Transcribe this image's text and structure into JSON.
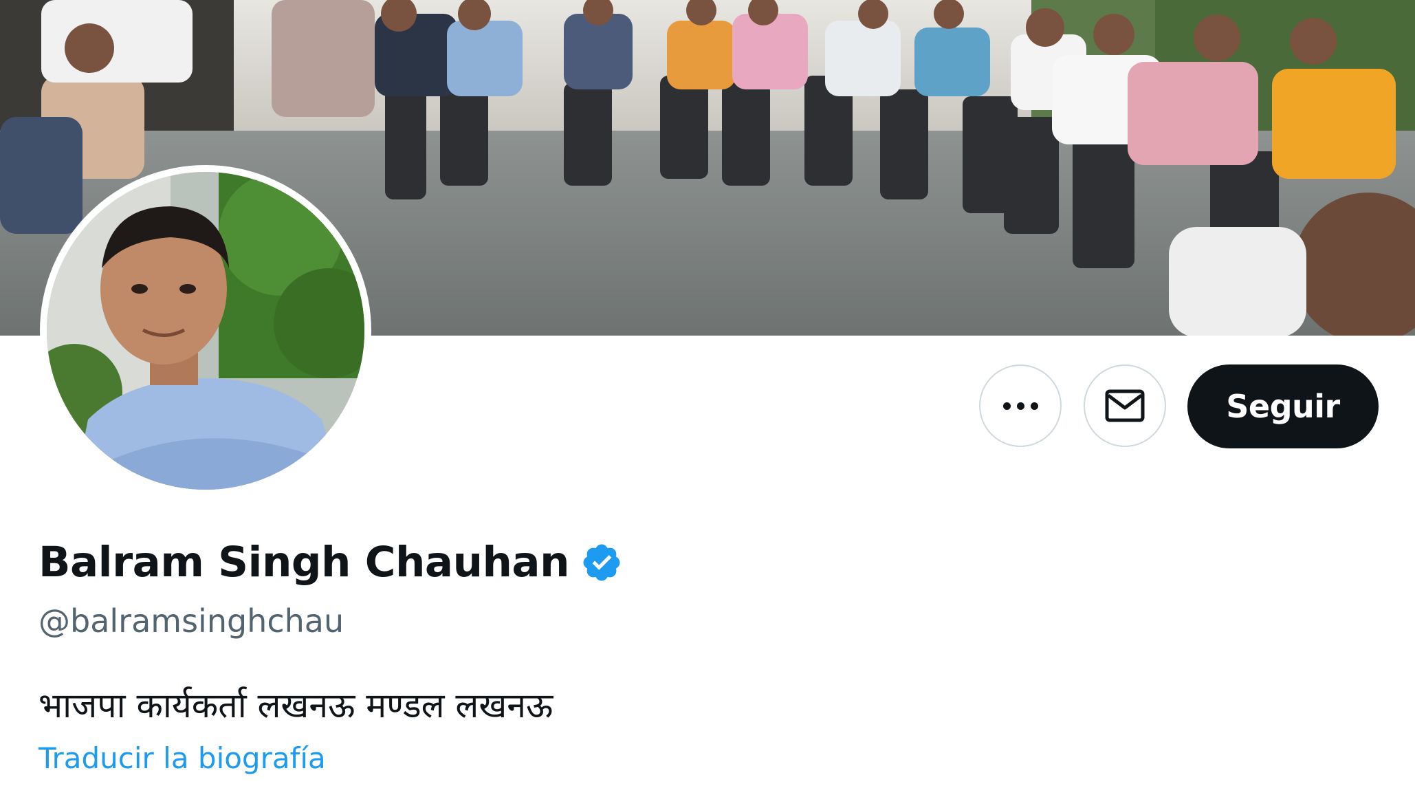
{
  "profile": {
    "display_name": "Balram Singh Chauhan",
    "handle": "@balramsinghchau",
    "bio": "भाजपा कार्यकर्ता लखनऊ मण्डल लखनऊ",
    "translate_bio_label": "Traducir la biografía",
    "verified": true
  },
  "actions": {
    "more_icon": "more-horizontal-icon",
    "message_icon": "envelope-icon",
    "follow_label": "Seguir"
  },
  "colors": {
    "text_primary": "#0f1419",
    "text_secondary": "#536471",
    "link": "#1d9bf0",
    "verified_badge": "#1d9bf0",
    "follow_button_bg": "#0f1419",
    "follow_button_text": "#ffffff",
    "button_border": "#cfd9de"
  }
}
